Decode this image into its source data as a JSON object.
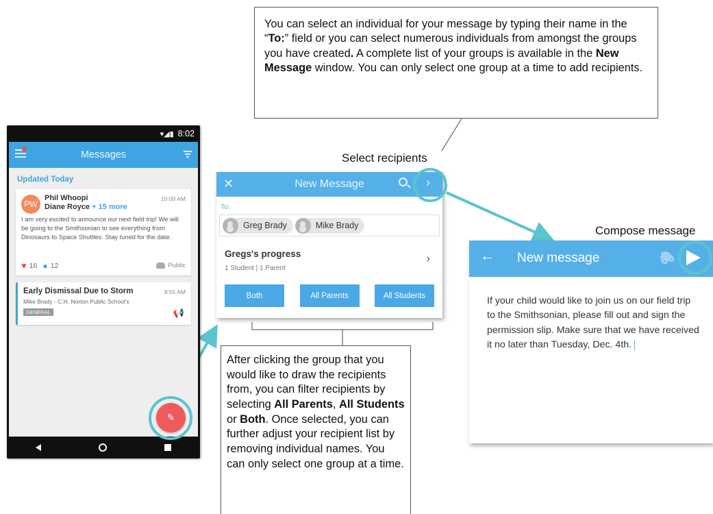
{
  "callout_top": {
    "segments": [
      {
        "t": "You can select an individual for your message by typing their name in the “",
        "b": false
      },
      {
        "t": "To:",
        "b": true
      },
      {
        "t": "” field or you can select numerous individuals from amongst the groups you have created",
        "b": false
      },
      {
        "t": ".",
        "b": true
      },
      {
        "t": " A complete list of your groups is available in the ",
        "b": false
      },
      {
        "t": "New Message",
        "b": true
      },
      {
        "t": " window. You can only select one group at a time to add recipients.",
        "b": false
      }
    ]
  },
  "callout_bottom": {
    "segments": [
      {
        "t": "After clicking the group that you would like to draw the recipients from, you can filter recipients by selecting ",
        "b": false
      },
      {
        "t": "All Parents",
        "b": true
      },
      {
        "t": ", ",
        "b": false
      },
      {
        "t": "All Students",
        "b": true
      },
      {
        "t": " or ",
        "b": false
      },
      {
        "t": "Both",
        "b": true
      },
      {
        "t": ". Once selected, you can further adjust your recipient list by removing individual names. You can only select one group at a time.",
        "b": false
      }
    ]
  },
  "labels": {
    "select_recipients": "Select recipients",
    "compose_message": "Compose message"
  },
  "phone": {
    "status_time": "8:02",
    "title": "Messages",
    "section": "Updated Today",
    "card1": {
      "avatar": "PW",
      "name1": "Phil Whoopi",
      "name2": "Diane Royce",
      "more": "+ 15 more",
      "time": "10:00 AM",
      "body": "I am very excited to announce our next field trip! We will be going to the Smithsonian to see everything from Dinosaurs to Space Shuttles. Stay tuned for the date.",
      "likes": "16",
      "comments": "12",
      "visibility": "Public"
    },
    "card2": {
      "title": "Early Dismissal Due to Storm",
      "time": "8:55 AM",
      "sub": "Mike Brady - C.H. Norton Public School's",
      "tag": "GENERAL"
    }
  },
  "new_message": {
    "title": "New Message",
    "to_label": "To:",
    "recipients": [
      "Greg Brady",
      "Mike Brady"
    ],
    "group_name": "Gregs's progress",
    "group_sub": "1 Student |  1 Parent",
    "buttons": [
      "Both",
      "All Parents",
      "All Students"
    ]
  },
  "compose": {
    "title": "New message",
    "body": "If your child would like to join us on our field trip to the Smithsonian, please fill out and sign the permission slip. Make sure that we have received it no later than Tuesday, Dec. 4th."
  },
  "colors": {
    "app_blue": "#3fa5e2",
    "highlight_ring": "#5ac4cf",
    "fab_red": "#ef5a5a"
  }
}
